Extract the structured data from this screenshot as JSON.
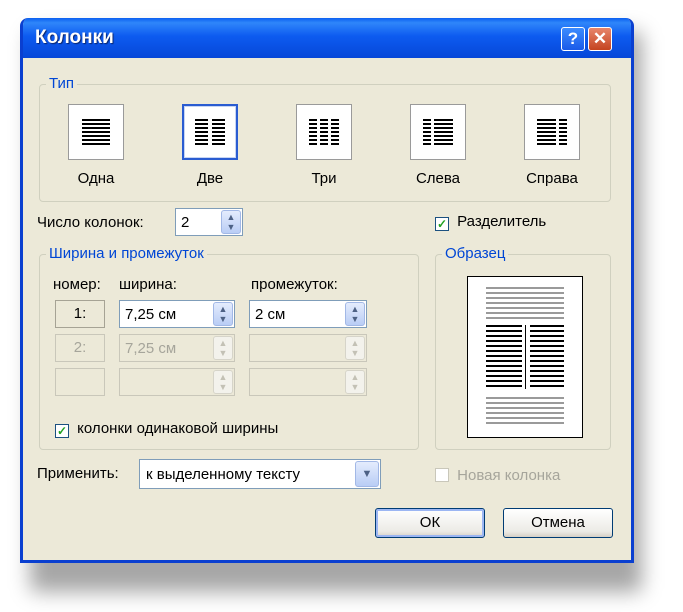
{
  "window": {
    "title": "Колонки",
    "help": "?",
    "close": "✕"
  },
  "type_group": {
    "label": "Тип",
    "items": [
      {
        "label": "Одна",
        "icon": "one-column-icon",
        "selected": false
      },
      {
        "label": "Две",
        "icon": "two-columns-icon",
        "selected": true
      },
      {
        "label": "Три",
        "icon": "three-columns-icon",
        "selected": false
      },
      {
        "label": "Слева",
        "icon": "left-column-icon",
        "selected": false
      },
      {
        "label": "Справа",
        "icon": "right-column-icon",
        "selected": false
      }
    ]
  },
  "num_columns": {
    "label": "Число колонок:",
    "value": "2"
  },
  "separator": {
    "label": "Разделитель",
    "checked": true
  },
  "width_group": {
    "label": "Ширина и промежуток",
    "col_header": "номер:",
    "width_header": "ширина:",
    "spacing_header": "промежуток:",
    "rows": [
      {
        "num": "1:",
        "width": "7,25 см",
        "spacing": "2 см",
        "enabled": true
      },
      {
        "num": "2:",
        "width": "7,25 см",
        "spacing": "",
        "enabled": false
      },
      {
        "num": "",
        "width": "",
        "spacing": "",
        "enabled": false
      }
    ],
    "equal_width": {
      "label": "колонки одинаковой ширины",
      "checked": true
    }
  },
  "sample": {
    "label": "Образец"
  },
  "apply": {
    "label": "Применить:",
    "value": "к выделенному тексту"
  },
  "new_column": {
    "label": "Новая колонка",
    "checked": false
  },
  "buttons": {
    "ok": "ОК",
    "cancel": "Отмена"
  },
  "colors": {
    "title_bar": "#0a5ff0",
    "dialog_bg": "#ece9d8",
    "group_label": "#0046d5"
  }
}
